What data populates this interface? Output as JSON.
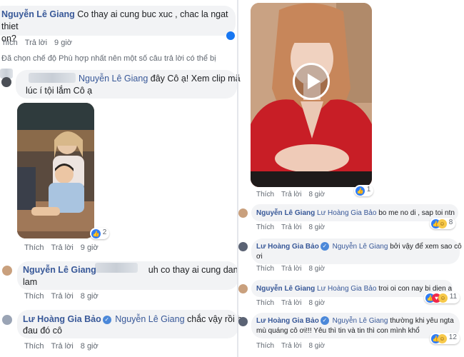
{
  "left": {
    "c1": {
      "name": "Nguyễn Lê Giang",
      "line1": "Co thay ai cung buc xuc , chac la ngat thiet",
      "line2": "on?",
      "like": "hích",
      "reply": "Trả lời",
      "time": "9 giờ"
    },
    "notice": "Đã chọn chế độ Phù hợp nhất nên một số câu trả lời có thể bị",
    "c2": {
      "tag": "Nguyễn Lê Giang",
      "line1": "đây Cô ạ! Xem clip mặ",
      "line2": "lúc í tội lắm Cô ạ",
      "reaction_count": "2",
      "like": "Thích",
      "reply": "Trả lời",
      "time": "9 giờ"
    },
    "c3": {
      "name": "Nguyễn Lê Giang",
      "line1": "uh co thay ai cung dan",
      "line2": "lam",
      "like": "Thích",
      "reply": "Trả lời",
      "time": "8 giờ"
    },
    "c4": {
      "name": "Lư Hoàng Gia Bảo",
      "tag": "Nguyễn Lê Giang",
      "line1": "chắc vậy rồi b",
      "line2": "đau đó cô",
      "like": "Thích",
      "reply": "Trả lời",
      "time": "8 giờ"
    }
  },
  "right": {
    "video": {
      "reaction_count": "1",
      "like": "Thích",
      "reply": "Trả lời",
      "time": "8 giờ"
    },
    "r1": {
      "name": "Nguyễn Lê Giang",
      "tag": "Lư Hoàng Gia Bảo",
      "text": "bo me no di , sap toi ntn",
      "reaction_count": "8",
      "like": "Thích",
      "reply": "Trả lời",
      "time": "8 giờ"
    },
    "r2": {
      "name": "Lư Hoàng Gia Bảo",
      "tag": "Nguyễn Lê Giang",
      "line1": "bởi vậy để xem sao cô",
      "line2": "ơi",
      "like": "Thích",
      "reply": "Trả lời",
      "time": "8 giờ"
    },
    "r3": {
      "name": "Nguyễn Lê Giang",
      "tag": "Lư Hoàng Gia Bảo",
      "text": "troi oi con nay bi dien a",
      "reaction_count": "11",
      "like": "Thích",
      "reply": "Trả lời",
      "time": "8 giờ"
    },
    "r4": {
      "name": "Lư Hoàng Gia Bảo",
      "tag": "Nguyễn Lê Giang",
      "line1": "thường khi yêu ngta",
      "line2": "mù quáng cô ơi!!! Yêu thì tin và tin thì con mình khổ",
      "reaction_count": "12",
      "like": "Thích",
      "reply": "Trả lời",
      "time": "8 giờ"
    }
  },
  "icons": {
    "like": "like-icon",
    "haha": "haha-icon",
    "love": "love-icon",
    "verified": "verified-badge-icon",
    "play": "play-icon"
  },
  "colors": {
    "link": "#385898",
    "bubble": "#f2f3f5",
    "meta": "#606770",
    "like_blue": "#2f7df6"
  }
}
